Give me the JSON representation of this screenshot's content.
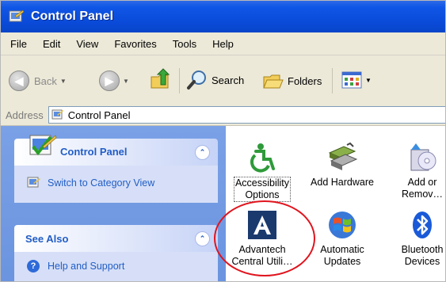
{
  "window": {
    "title": "Control Panel"
  },
  "menu": {
    "items": [
      "File",
      "Edit",
      "View",
      "Favorites",
      "Tools",
      "Help"
    ]
  },
  "toolbar": {
    "back_label": "Back",
    "search_label": "Search",
    "folders_label": "Folders"
  },
  "address": {
    "label": "Address",
    "value": "Control Panel"
  },
  "left_pane": {
    "control_panel_box": {
      "title": "Control Panel",
      "link": "Switch to Category View"
    },
    "see_also_box": {
      "title": "See Also",
      "link": "Help and Support"
    }
  },
  "items": [
    {
      "line1": "Accessibility",
      "line2": "Options",
      "icon": "accessibility-icon"
    },
    {
      "line1": "Add Hardware",
      "line2": "",
      "icon": "add-hardware-icon"
    },
    {
      "line1": "Add or",
      "line2": "Remov…",
      "icon": "add-remove-programs-icon"
    },
    {
      "line1": "Advantech",
      "line2": "Central Utili…",
      "icon": "advantech-icon"
    },
    {
      "line1": "Automatic",
      "line2": "Updates",
      "icon": "windows-flag-icon"
    },
    {
      "line1": "Bluetooth",
      "line2": "Devices",
      "icon": "bluetooth-icon"
    }
  ],
  "colors": {
    "titlebar": "#0a4ad8",
    "annotation": "#e0141e",
    "advantech": "#1a3a6e"
  }
}
